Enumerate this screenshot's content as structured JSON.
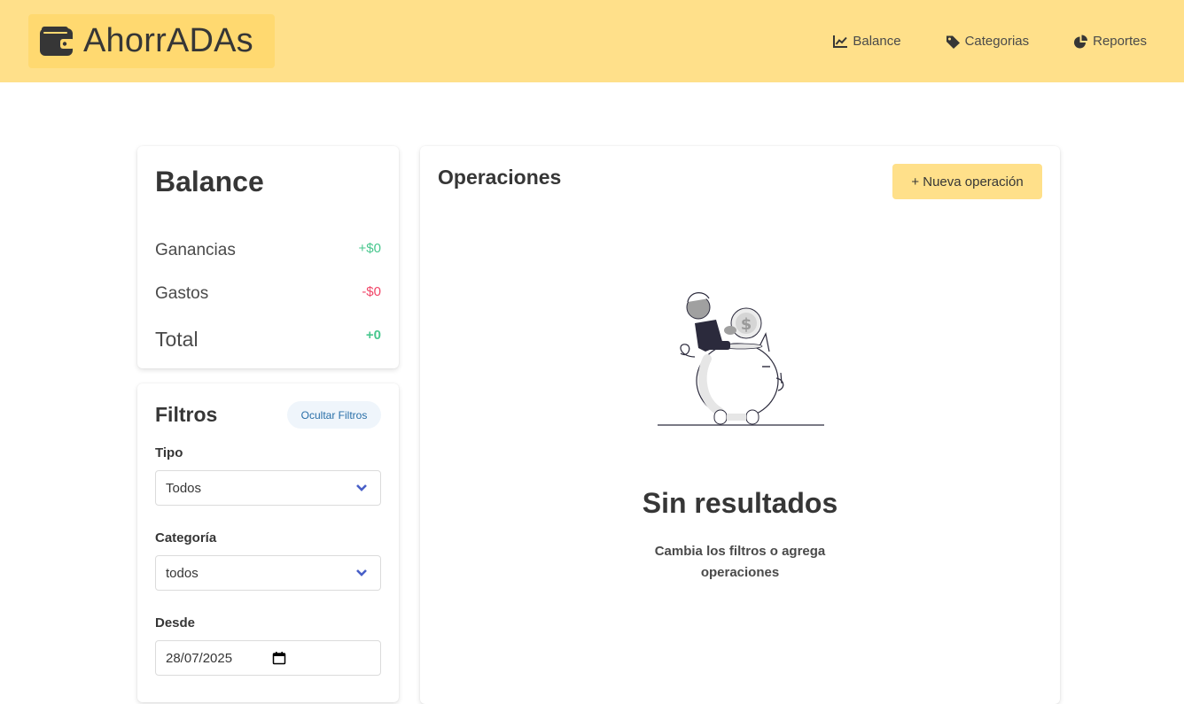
{
  "header": {
    "brand": "AhorrADAs",
    "brand_icon": "wallet-icon",
    "nav": [
      {
        "label": "Balance",
        "icon": "chart-line-icon"
      },
      {
        "label": "Categorias",
        "icon": "tag-icon"
      },
      {
        "label": "Reportes",
        "icon": "pie-chart-icon"
      }
    ],
    "background": "#ffe08a"
  },
  "balance": {
    "title": "Balance",
    "rows": [
      {
        "label": "Ganancias",
        "value": "+$0",
        "color": "#48c78e"
      },
      {
        "label": "Gastos",
        "value": "-$0",
        "color": "#f14668"
      },
      {
        "label": "Total",
        "value": "+0",
        "color": "#48c78e"
      }
    ]
  },
  "filters": {
    "title": "Filtros",
    "hide_button": "Ocultar Filtros",
    "tipo": {
      "label": "Tipo",
      "value": "Todos"
    },
    "categoria": {
      "label": "Categoría",
      "value": "todos"
    },
    "desde": {
      "label": "Desde",
      "value": "28/07/2025"
    }
  },
  "operations": {
    "title": "Operaciones",
    "new_button": "+ Nueva operación",
    "empty_title": "Sin resultados",
    "empty_subtitle": "Cambia los filtros o agrega operaciones",
    "illustration": "piggy-bank-illustration"
  }
}
